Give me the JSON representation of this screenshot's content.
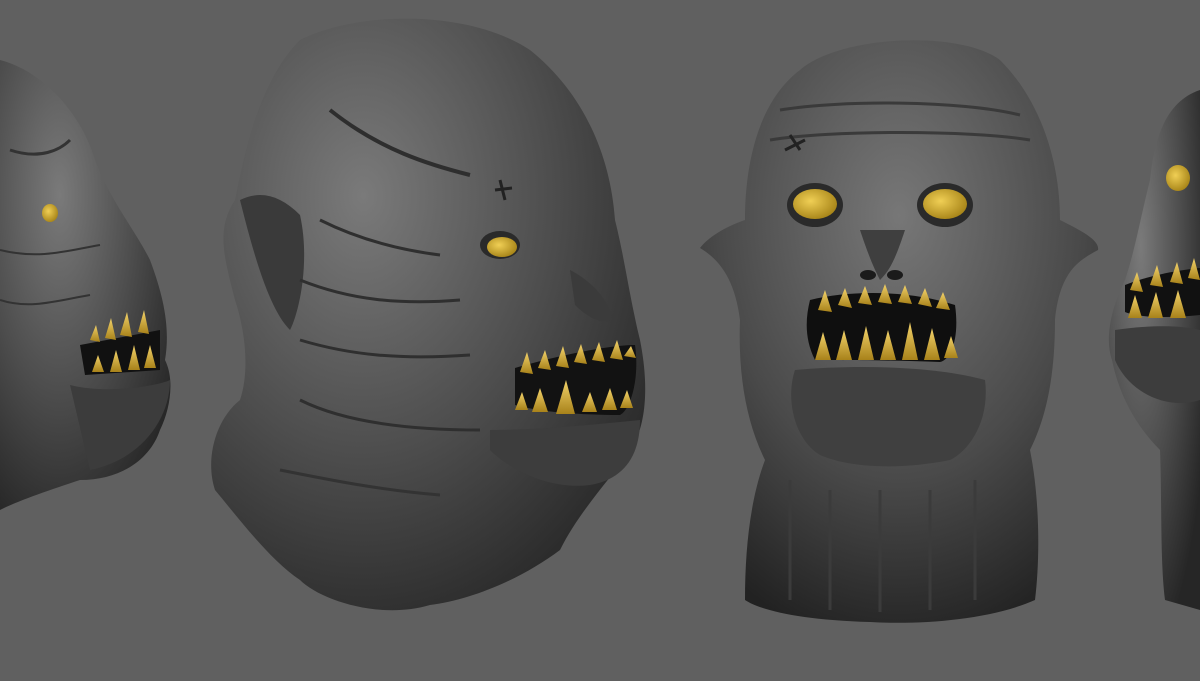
{
  "scene": {
    "background_color": "#606060",
    "sculpt_clay_color": "#4a4a4a",
    "teeth_color": "#c9a22a",
    "eye_color": "#c8a526",
    "views": [
      {
        "name": "profile-left-partial",
        "facing": "right"
      },
      {
        "name": "three-quarter",
        "facing": "right"
      },
      {
        "name": "front",
        "facing": "viewer"
      },
      {
        "name": "profile-right-partial",
        "facing": "left"
      }
    ]
  }
}
